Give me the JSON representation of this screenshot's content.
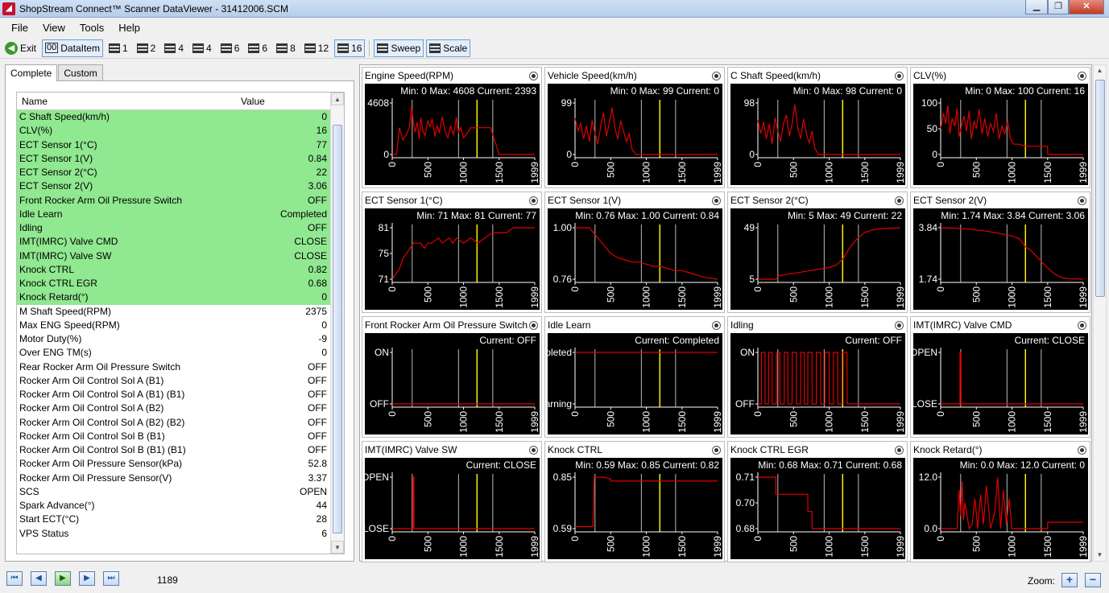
{
  "window": {
    "title": "ShopStream Connect™ Scanner DataViewer - 31412006.SCM",
    "app_icon": "app-logo",
    "controls": [
      "minimize",
      "maximize",
      "close"
    ]
  },
  "menu": [
    "File",
    "View",
    "Tools",
    "Help"
  ],
  "toolbar": {
    "exit": "Exit",
    "dataitem": "DataItem",
    "layouts": [
      "1",
      "2",
      "4",
      "4",
      "6",
      "6",
      "8",
      "12",
      "16"
    ],
    "sweep": "Sweep",
    "scale": "Scale"
  },
  "tabs": [
    "Complete",
    "Custom"
  ],
  "grid": {
    "col_name": "Name",
    "col_value": "Value",
    "rows": [
      {
        "name": "C Shaft Speed(km/h)",
        "value": "0",
        "sel": true
      },
      {
        "name": "CLV(%)",
        "value": "16",
        "sel": true
      },
      {
        "name": "ECT Sensor 1(°C)",
        "value": "77",
        "sel": true
      },
      {
        "name": "ECT Sensor 1(V)",
        "value": "0.84",
        "sel": true
      },
      {
        "name": "ECT Sensor 2(°C)",
        "value": "22",
        "sel": true
      },
      {
        "name": "ECT Sensor 2(V)",
        "value": "3.06",
        "sel": true
      },
      {
        "name": "Front Rocker Arm Oil Pressure Switch",
        "value": "OFF",
        "sel": true
      },
      {
        "name": "Idle Learn",
        "value": "Completed",
        "sel": true
      },
      {
        "name": "Idling",
        "value": "OFF",
        "sel": true
      },
      {
        "name": "IMT(IMRC) Valve CMD",
        "value": "CLOSE",
        "sel": true
      },
      {
        "name": "IMT(IMRC) Valve SW",
        "value": "CLOSE",
        "sel": true
      },
      {
        "name": "Knock CTRL",
        "value": "0.82",
        "sel": true
      },
      {
        "name": "Knock CTRL EGR",
        "value": "0.68",
        "sel": true
      },
      {
        "name": "Knock Retard(°)",
        "value": "0",
        "sel": true
      },
      {
        "name": "M Shaft Speed(RPM)",
        "value": "2375",
        "sel": false
      },
      {
        "name": "Max ENG Speed(RPM)",
        "value": "0",
        "sel": false
      },
      {
        "name": "Motor Duty(%)",
        "value": "-9",
        "sel": false
      },
      {
        "name": "Over ENG TM(s)",
        "value": "0",
        "sel": false
      },
      {
        "name": "Rear Rocker Arm Oil Pressure Switch",
        "value": "OFF",
        "sel": false
      },
      {
        "name": "Rocker Arm Oil Control Sol A (B1)",
        "value": "OFF",
        "sel": false
      },
      {
        "name": "Rocker Arm Oil Control Sol A (B1) (B1)",
        "value": "OFF",
        "sel": false
      },
      {
        "name": "Rocker Arm Oil Control Sol A (B2)",
        "value": "OFF",
        "sel": false
      },
      {
        "name": "Rocker Arm Oil Control Sol A (B2) (B2)",
        "value": "OFF",
        "sel": false
      },
      {
        "name": "Rocker Arm Oil Control Sol B (B1)",
        "value": "OFF",
        "sel": false
      },
      {
        "name": "Rocker Arm Oil Control Sol B (B1) (B1)",
        "value": "OFF",
        "sel": false
      },
      {
        "name": "Rocker Arm Oil Pressure Sensor(kPa)",
        "value": "52.8",
        "sel": false
      },
      {
        "name": "Rocker Arm Oil Pressure Sensor(V)",
        "value": "3.37",
        "sel": false
      },
      {
        "name": "SCS",
        "value": "OPEN",
        "sel": false
      },
      {
        "name": "Spark Advance(°)",
        "value": "44",
        "sel": false
      },
      {
        "name": "Start ECT(°C)",
        "value": "28",
        "sel": false
      },
      {
        "name": "VPS Status",
        "value": "6",
        "sel": false
      }
    ]
  },
  "colors": {
    "trace": "#e00000",
    "cursor": "#ffee00",
    "marker": "#bbbbbb",
    "plot_bg": "#000000",
    "selected_row": "#90e890"
  },
  "x_ticks": [
    "0",
    "500",
    "1000",
    "1500",
    "1999"
  ],
  "markers": [
    280,
    930,
    1410
  ],
  "cursor": 1189,
  "chart_data": [
    {
      "name": "Engine Speed(RPM)",
      "type": "line",
      "stats": [
        "Min: 0",
        "Max: 4608",
        "Current: 2393"
      ],
      "ylabels": [
        "4608",
        "0"
      ],
      "ymin": 0,
      "ymax": 4608,
      "x": [
        0,
        60,
        100,
        150,
        200,
        240,
        270,
        300,
        320,
        350,
        380,
        400,
        430,
        460,
        500,
        530,
        560,
        600,
        630,
        660,
        700,
        740,
        780,
        820,
        860,
        900,
        930,
        960,
        1000,
        1050,
        1100,
        1189,
        1200,
        1300,
        1380,
        1500,
        1999
      ],
      "y": [
        0,
        0,
        2400,
        1300,
        1800,
        2400,
        4300,
        2700,
        2000,
        2900,
        1400,
        3300,
        2100,
        1700,
        3000,
        2500,
        3200,
        1600,
        2600,
        1900,
        3400,
        2100,
        1500,
        2600,
        1700,
        3300,
        2000,
        2400,
        1500,
        1900,
        2400,
        2393,
        2400,
        2400,
        2400,
        0,
        0
      ]
    },
    {
      "name": "Vehicle Speed(km/h)",
      "type": "line",
      "stats": [
        "Min: 0",
        "Max: 99",
        "Current: 0"
      ],
      "ylabels": [
        "99",
        "0"
      ],
      "ymin": 0,
      "ymax": 99,
      "x": [
        0,
        40,
        80,
        120,
        160,
        200,
        240,
        280,
        320,
        360,
        400,
        440,
        480,
        520,
        560,
        600,
        640,
        680,
        720,
        760,
        800,
        850,
        900,
        1999
      ],
      "y": [
        70,
        45,
        60,
        30,
        55,
        25,
        65,
        40,
        20,
        55,
        80,
        35,
        60,
        90,
        50,
        30,
        65,
        45,
        25,
        40,
        10,
        0,
        0,
        0
      ]
    },
    {
      "name": "C Shaft Speed(km/h)",
      "type": "line",
      "stats": [
        "Min: 0",
        "Max: 98",
        "Current: 0"
      ],
      "ylabels": [
        "98",
        "0"
      ],
      "ymin": 0,
      "ymax": 98,
      "x": [
        0,
        40,
        80,
        120,
        160,
        200,
        240,
        280,
        320,
        360,
        400,
        440,
        480,
        520,
        560,
        600,
        640,
        680,
        720,
        760,
        800,
        850,
        900,
        1999
      ],
      "y": [
        65,
        40,
        62,
        30,
        58,
        20,
        70,
        45,
        25,
        60,
        75,
        35,
        58,
        95,
        50,
        30,
        68,
        40,
        22,
        45,
        12,
        0,
        0,
        0
      ]
    },
    {
      "name": "CLV(%)",
      "type": "line",
      "stats": [
        "Min: 0",
        "Max: 100",
        "Current: 16"
      ],
      "ylabels": [
        "100",
        "50",
        "0"
      ],
      "ymin": 0,
      "ymax": 100,
      "x": [
        0,
        40,
        70,
        100,
        130,
        160,
        200,
        230,
        260,
        300,
        330,
        360,
        400,
        430,
        470,
        500,
        540,
        580,
        620,
        660,
        700,
        740,
        780,
        820,
        860,
        900,
        940,
        980,
        1020,
        1100,
        1200,
        1300,
        1500,
        1501,
        1999
      ],
      "y": [
        50,
        80,
        60,
        95,
        40,
        70,
        55,
        90,
        35,
        60,
        75,
        45,
        85,
        30,
        65,
        50,
        88,
        40,
        70,
        35,
        60,
        45,
        80,
        30,
        55,
        40,
        65,
        30,
        20,
        20,
        16,
        16,
        16,
        0,
        0
      ]
    },
    {
      "name": "ECT Sensor 1(°C)",
      "type": "line",
      "stats": [
        "Min: 71",
        "Max: 81",
        "Current: 77"
      ],
      "ylabels": [
        "81",
        "75",
        "71"
      ],
      "ymin": 71,
      "ymax": 81,
      "x": [
        0,
        50,
        100,
        150,
        200,
        250,
        300,
        400,
        450,
        500,
        550,
        650,
        700,
        800,
        850,
        900,
        1000,
        1100,
        1200,
        1300,
        1400,
        1500,
        1600,
        1700,
        1850,
        1999
      ],
      "y": [
        71,
        72,
        73,
        75,
        76,
        77,
        78,
        78,
        77,
        78,
        78,
        79,
        78,
        79,
        78,
        79,
        78,
        79,
        78,
        79,
        80,
        80,
        80,
        81,
        81,
        81
      ]
    },
    {
      "name": "ECT Sensor 1(V)",
      "type": "line",
      "stats": [
        "Min: 0.76",
        "Max: 1.00",
        "Current: 0.84"
      ],
      "ylabels": [
        "1.00",
        "0.76"
      ],
      "ymin": 0.76,
      "ymax": 1.0,
      "x": [
        0,
        200,
        300,
        400,
        500,
        600,
        700,
        800,
        900,
        1000,
        1100,
        1200,
        1300,
        1400,
        1500,
        1600,
        1700,
        1800,
        1999
      ],
      "y": [
        1.0,
        1.0,
        0.96,
        0.92,
        0.88,
        0.86,
        0.85,
        0.84,
        0.84,
        0.83,
        0.82,
        0.82,
        0.81,
        0.8,
        0.8,
        0.79,
        0.78,
        0.77,
        0.76
      ]
    },
    {
      "name": "ECT Sensor 2(°C)",
      "type": "line",
      "stats": [
        "Min: 5",
        "Max: 49",
        "Current: 22"
      ],
      "ylabels": [
        "49",
        "5"
      ],
      "ymin": 5,
      "ymax": 49,
      "x": [
        0,
        250,
        300,
        400,
        500,
        600,
        700,
        800,
        900,
        1000,
        1100,
        1189,
        1250,
        1300,
        1400,
        1500,
        1600,
        1700,
        1999
      ],
      "y": [
        5,
        5,
        8,
        9,
        10,
        11,
        12,
        13,
        14,
        15,
        17,
        22,
        28,
        33,
        40,
        45,
        47,
        48,
        49
      ]
    },
    {
      "name": "ECT Sensor 2(V)",
      "type": "line",
      "stats": [
        "Min: 1.74",
        "Max: 3.84",
        "Current: 3.06"
      ],
      "ylabels": [
        "3.84",
        "1.74"
      ],
      "ymin": 1.74,
      "ymax": 3.84,
      "x": [
        0,
        200,
        400,
        600,
        800,
        1000,
        1100,
        1189,
        1250,
        1300,
        1400,
        1500,
        1600,
        1700,
        1800,
        1999
      ],
      "y": [
        3.84,
        3.82,
        3.78,
        3.72,
        3.62,
        3.5,
        3.4,
        3.06,
        2.95,
        2.8,
        2.5,
        2.2,
        1.95,
        1.8,
        1.76,
        1.74
      ]
    },
    {
      "name": "Front Rocker Arm Oil Pressure Switch",
      "type": "line",
      "stats": [
        "Current: OFF"
      ],
      "ylabels": [
        "ON",
        "OFF"
      ],
      "ymin": 0,
      "ymax": 1,
      "x": [
        0,
        1999
      ],
      "y": [
        0,
        0
      ]
    },
    {
      "name": "Idle Learn",
      "type": "line",
      "stats": [
        "Current: Completed"
      ],
      "ylabels": [
        "Completed",
        "Learning"
      ],
      "ymin": 0,
      "ymax": 1,
      "x": [
        0,
        1999
      ],
      "y": [
        1,
        1
      ]
    },
    {
      "name": "Idling",
      "type": "line",
      "stats": [
        "Current: OFF"
      ],
      "ylabels": [
        "ON",
        "OFF"
      ],
      "ymin": 0,
      "ymax": 1,
      "x": [
        0,
        50,
        51,
        100,
        101,
        150,
        151,
        200,
        201,
        260,
        261,
        310,
        311,
        370,
        371,
        420,
        421,
        480,
        481,
        540,
        541,
        600,
        601,
        650,
        651,
        700,
        701,
        760,
        761,
        820,
        821,
        880,
        881,
        940,
        941,
        1000,
        1001,
        1060,
        1061,
        1120,
        1121,
        1180,
        1181,
        1250,
        1251,
        1999
      ],
      "y": [
        0,
        0,
        1,
        1,
        0,
        0,
        1,
        1,
        0,
        0,
        1,
        1,
        0,
        0,
        1,
        1,
        0,
        0,
        1,
        1,
        0,
        0,
        1,
        1,
        0,
        0,
        1,
        1,
        0,
        0,
        1,
        1,
        0,
        0,
        1,
        1,
        0,
        0,
        1,
        1,
        0,
        0,
        1,
        1,
        0,
        0
      ]
    },
    {
      "name": "IMT(IMRC) Valve CMD",
      "type": "line",
      "stats": [
        "Current: CLOSE"
      ],
      "ylabels": [
        "OPEN",
        "CLOSE"
      ],
      "ymin": 0,
      "ymax": 1,
      "x": [
        0,
        270,
        271,
        285,
        286,
        1999
      ],
      "y": [
        0,
        0,
        1,
        1,
        0,
        0
      ]
    },
    {
      "name": "IMT(IMRC) Valve SW",
      "type": "line",
      "stats": [
        "Current: CLOSE"
      ],
      "ylabels": [
        "OPEN",
        "CLOSE"
      ],
      "ymin": 0,
      "ymax": 1,
      "x": [
        0,
        290,
        291,
        305,
        306,
        1999
      ],
      "y": [
        0,
        0,
        1,
        1,
        0,
        0
      ]
    },
    {
      "name": "Knock CTRL",
      "type": "line",
      "stats": [
        "Min: 0.59",
        "Max: 0.85",
        "Current: 0.82"
      ],
      "ylabels": [
        "0.85",
        "0.59"
      ],
      "ymin": 0.59,
      "ymax": 0.85,
      "x": [
        0,
        250,
        270,
        400,
        500,
        501,
        1999
      ],
      "y": [
        0.6,
        0.6,
        0.85,
        0.85,
        0.84,
        0.83,
        0.83
      ]
    },
    {
      "name": "Knock CTRL EGR",
      "type": "line",
      "stats": [
        "Min: 0.68",
        "Max: 0.71",
        "Current: 0.68"
      ],
      "ylabels": [
        "0.71",
        "0.70",
        "0.68"
      ],
      "ymin": 0.68,
      "ymax": 0.71,
      "x": [
        0,
        250,
        251,
        700,
        701,
        760,
        761,
        1999
      ],
      "y": [
        0.71,
        0.71,
        0.7,
        0.7,
        0.69,
        0.69,
        0.68,
        0.68
      ]
    },
    {
      "name": "Knock Retard(°)",
      "type": "line",
      "stats": [
        "Min: 0.0",
        "Max: 12.0",
        "Current: 0"
      ],
      "ylabels": [
        "12.0",
        "0.0"
      ],
      "ymin": 0,
      "ymax": 12,
      "x": [
        0,
        230,
        260,
        280,
        300,
        320,
        340,
        400,
        440,
        480,
        520,
        560,
        600,
        640,
        700,
        760,
        800,
        840,
        880,
        920,
        960,
        1000,
        1050,
        1100,
        1200,
        1500,
        1501,
        1999
      ],
      "y": [
        0,
        0,
        9,
        3,
        11,
        2,
        6,
        0,
        1,
        7,
        0,
        8,
        1,
        10,
        0,
        4,
        12,
        0,
        9,
        1,
        7,
        0,
        0,
        0,
        0,
        0,
        1.5,
        1.5
      ]
    }
  ],
  "status": {
    "frame": "1189",
    "zoom_label": "Zoom:"
  }
}
